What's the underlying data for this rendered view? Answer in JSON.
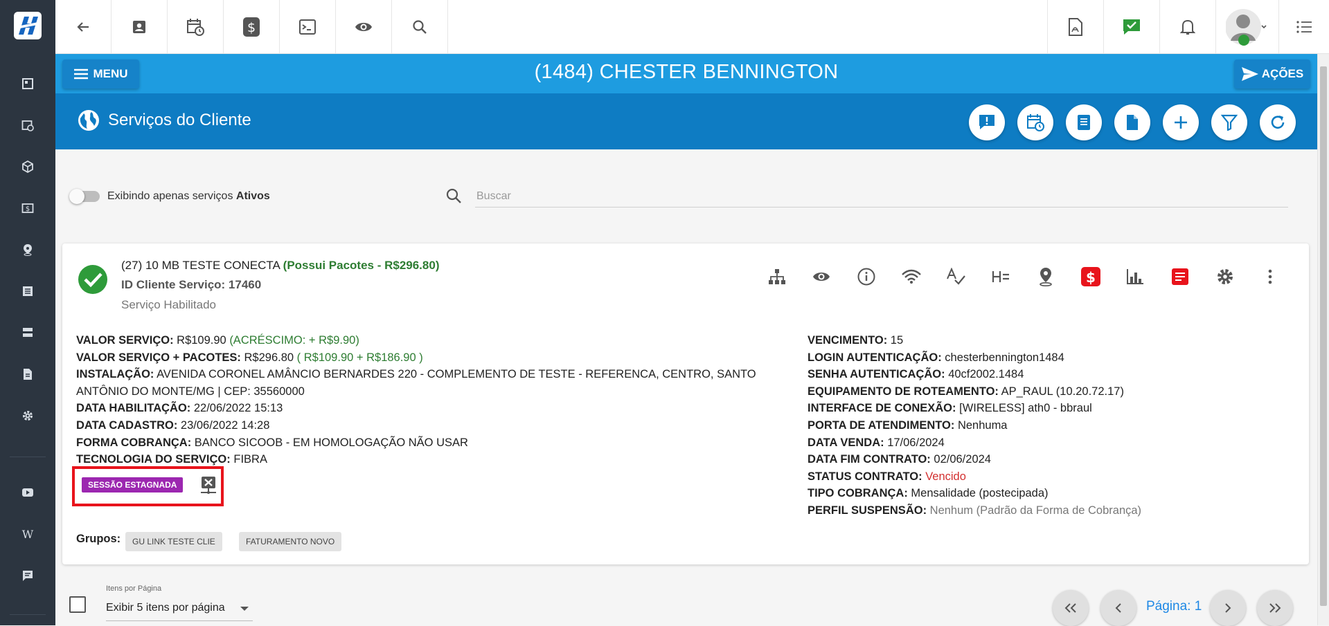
{
  "header": {
    "menu_label": "MENU",
    "client_title": "(1484) CHESTER BENNINGTON",
    "acoes_label": "AÇÕES",
    "page_title": "Serviços do Cliente"
  },
  "filter": {
    "toggle_text": "Exibindo apenas serviços ",
    "toggle_bold": "Ativos",
    "toggle_on": false,
    "search_placeholder": "Buscar",
    "search_value": ""
  },
  "service": {
    "title": "(27) 10 MB TESTE CONECTA ",
    "packages": "(Possui Pacotes - R$296.80)",
    "id_line": "ID Cliente Serviço: 17460",
    "status": "Serviço Habilitado",
    "left": {
      "valor_label": "VALOR SERVIÇO:",
      "valor": " R$109.90 ",
      "acrescimo": "(ACRÉSCIMO: + R$9.90)",
      "pacotes_label": "VALOR SERVIÇO + PACOTES:",
      "pacotes": " R$296.80 ",
      "pacotes_detail": "( R$109.90 + R$186.90 )",
      "instalacao_label": "INSTALAÇÃO:",
      "instalacao": " AVENIDA CORONEL AMÂNCIO BERNARDES 220 - COMPLEMENTO DE TESTE - REFERENCA, CENTRO, SANTO ANTÔNIO DO MONTE/MG | CEP: 35560000",
      "habilitacao_label": "DATA HABILITAÇÃO:",
      "habilitacao": " 22/06/2022 15:13",
      "cadastro_label": "DATA CADASTRO:",
      "cadastro": " 23/06/2022 14:28",
      "cobranca_label": "FORMA COBRANÇA:",
      "cobranca": " BANCO SICOOB - EM HOMOLOGAÇÃO NÃO USAR",
      "tecnologia_label": "TECNOLOGIA DO SERVIÇO:",
      "tecnologia": " FIBRA"
    },
    "right": {
      "vencimento_label": "VENCIMENTO:",
      "vencimento": " 15",
      "login_label": "LOGIN AUTENTICAÇÃO:",
      "login": " chesterbennington1484",
      "senha_label": "SENHA AUTENTICAÇÃO:",
      "senha": " 40cf2002.1484",
      "equip_label": "EQUIPAMENTO DE ROTEAMENTO:",
      "equip": " AP_RAUL (10.20.72.17)",
      "interface_label": "INTERFACE DE CONEXÃO:",
      "interface": " [WIRELESS] ath0 - bbraul",
      "porta_label": "PORTA DE ATENDIMENTO:",
      "porta": " Nenhuma",
      "venda_label": "DATA VENDA:",
      "venda": " 17/06/2024",
      "fim_label": "DATA FIM CONTRATO:",
      "fim": " 02/06/2024",
      "status_label": "STATUS CONTRATO:",
      "status_val": " Vencido",
      "tipo_label": "TIPO COBRANÇA:",
      "tipo": " Mensalidade (postecipada)",
      "perfil_label": "PERFIL SUSPENSÃO:",
      "perfil": " Nenhum (Padrão da Forma de Cobrança)"
    },
    "session_badge": "SESSÃO ESTAGNADA",
    "groups_label": "Grupos:",
    "groups": [
      "GU LINK TESTE CLIE",
      "FATURAMENTO NOVO"
    ]
  },
  "pagination": {
    "perpage_label": "Itens por Página",
    "perpage_value": "Exibir 5 itens por página",
    "page_label": "Página: 1"
  },
  "colors": {
    "header_blue": "#1e9ce0",
    "header_dark_blue": "#0e7cc3",
    "sidebar": "#2c3540",
    "session_purple": "#9c27b0",
    "success_green": "#2e7d32",
    "danger_red": "#d32f2f",
    "highlight_red": "#e8141c"
  },
  "icons": {
    "sidebar": [
      "dashboard-icon",
      "calendar-clock-icon",
      "package-icon",
      "money-icon",
      "map-pin-icon",
      "list-icon",
      "server-icon",
      "document-icon",
      "settings-icon",
      "youtube-icon",
      "wiki-icon",
      "chat-icon"
    ],
    "toolbar": [
      "back-arrow-icon",
      "contact-icon",
      "calendar-clock-icon",
      "dollar-icon",
      "terminal-icon",
      "eye-icon",
      "search-icon",
      "pdf-icon",
      "check-message-icon",
      "bell-icon",
      "avatar",
      "list-menu-icon"
    ],
    "header_actions": [
      "alert-icon",
      "calendar-clock-icon",
      "receipt-icon",
      "file-icon",
      "add-icon",
      "filter-icon",
      "refresh-icon"
    ],
    "service_actions": [
      "network-tree-icon",
      "eye-icon",
      "info-icon",
      "wifi-icon",
      "spellcheck-icon",
      "h-equal-icon",
      "map-pin-icon",
      "dollar-icon",
      "chart-icon",
      "notes-icon",
      "settings-icon",
      "more-vert-icon"
    ]
  }
}
